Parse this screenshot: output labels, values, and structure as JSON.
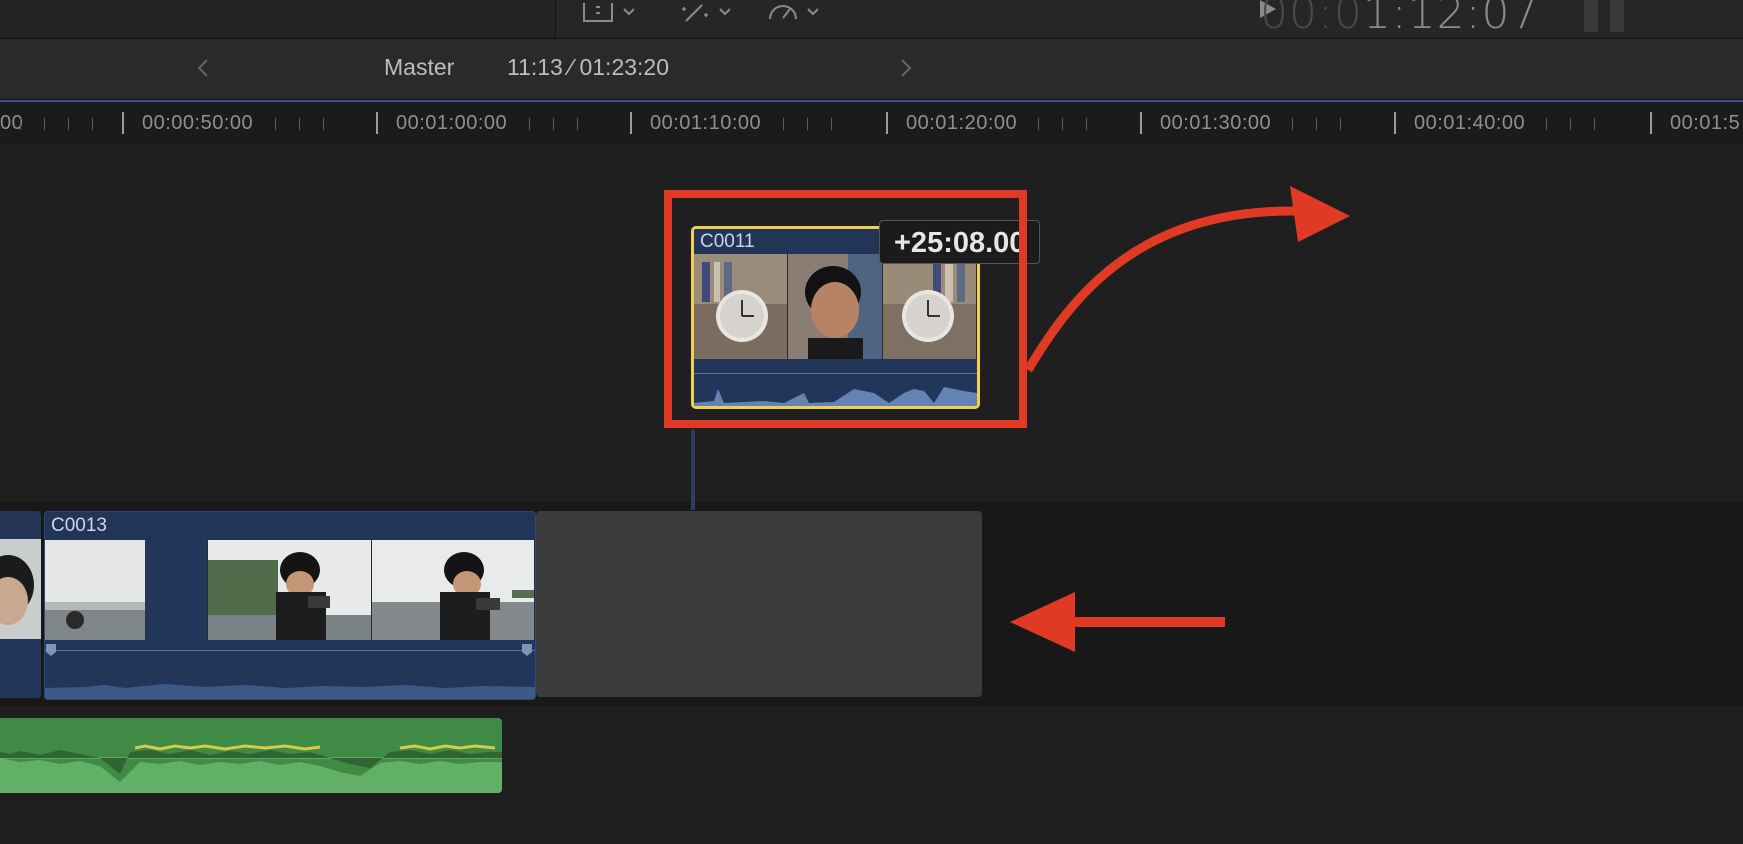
{
  "toolbar": {
    "icons": [
      "trim-icon",
      "magic-wand-icon",
      "speedometer-icon"
    ],
    "timecode_dim": "00:0",
    "timecode_bright": "1:12:07"
  },
  "nav": {
    "label": "Master",
    "position": "11:13 ⁄ 01:23:20"
  },
  "ruler": {
    "labels": [
      "00:00:50:00",
      "00:01:00:00",
      "00:01:10:00",
      "00:01:20:00",
      "00:01:30:00",
      "00:01:40:00",
      "00:01:5"
    ],
    "left_fragment": "00"
  },
  "clips": {
    "connected": {
      "name": "C0011"
    },
    "primary": {
      "name": "C0013"
    }
  },
  "drag_offset": "+25:08.00",
  "annotation_color": "#e03a25",
  "selection_color": "#f1d04f"
}
